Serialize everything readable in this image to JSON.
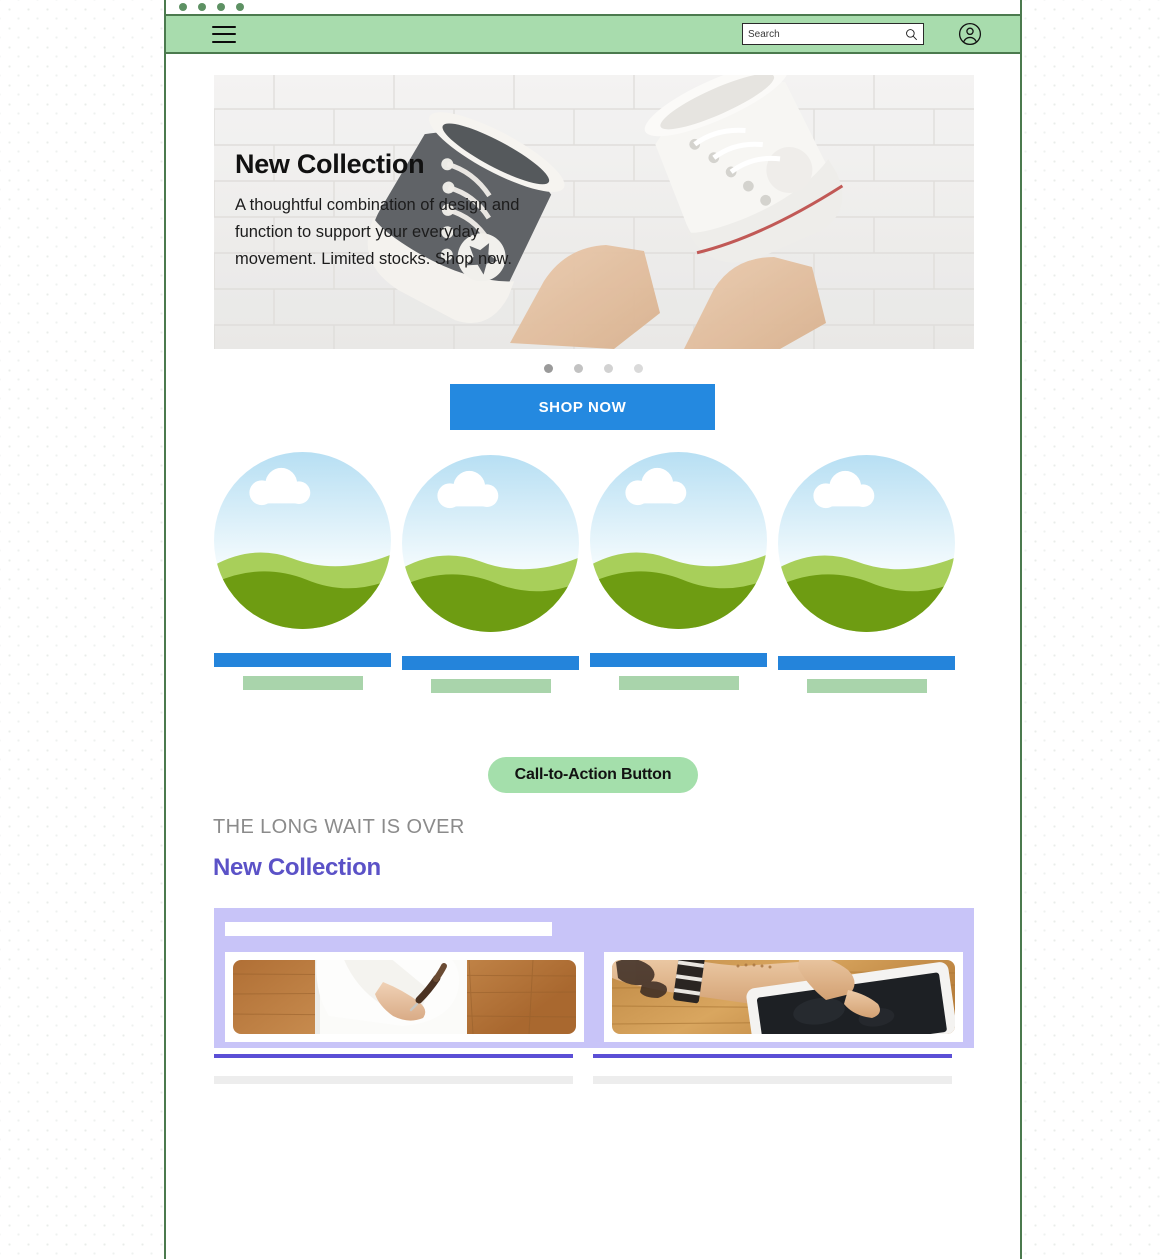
{
  "window": {
    "dot_count": 4,
    "dot_color": "#5d9163",
    "frame_border_color": "#4b7a4e"
  },
  "header": {
    "background": "#a8dcad",
    "menu_icon": "hamburger-menu-icon",
    "search": {
      "placeholder": "Search",
      "value": "",
      "icon": "search-icon"
    },
    "account_icon": "user-account-icon"
  },
  "hero": {
    "title": "New Collection",
    "body": "A thoughtful combination of design and function to support your everyday movement. Limited stocks. Shop now.",
    "image_alt": "sneakers-against-white-brick-wall"
  },
  "carousel": {
    "dots": [
      {
        "active": true,
        "color": "#9a9a9a"
      },
      {
        "active": false,
        "color": "#c2c2c2"
      },
      {
        "active": false,
        "color": "#d2d2d2"
      },
      {
        "active": false,
        "color": "#dadada"
      }
    ]
  },
  "shop_now": {
    "label": "SHOP NOW",
    "color": "#2489e0"
  },
  "product_cards": [
    {
      "image_alt": "landscape-placeholder",
      "offset": false
    },
    {
      "image_alt": "landscape-placeholder",
      "offset": true
    },
    {
      "image_alt": "landscape-placeholder",
      "offset": false
    },
    {
      "image_alt": "landscape-placeholder",
      "offset": true
    }
  ],
  "cta": {
    "label": "Call-to-Action Button",
    "color": "#a4dfab"
  },
  "section": {
    "eyebrow": "THE LONG WAIT IS OVER",
    "title": "New Collection",
    "title_color": "#5b52c7"
  },
  "panel": {
    "background": "#c8c4f8",
    "cards": [
      {
        "image_alt": "hand-writing-on-paper-at-wooden-desk"
      },
      {
        "image_alt": "tattooed-arm-holding-tablet-on-wooden-desk"
      }
    ],
    "underline_color": "#5b4fd6"
  }
}
